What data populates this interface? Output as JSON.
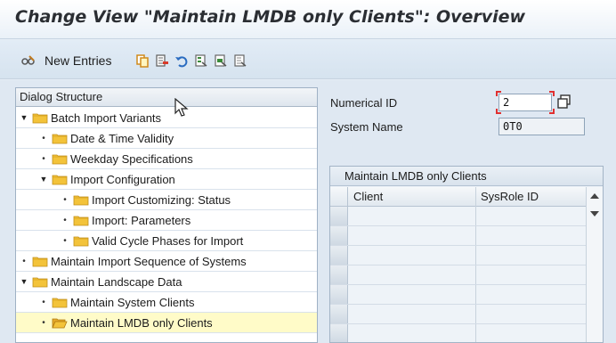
{
  "title": "Change View \"Maintain LMDB only Clients\": Overview",
  "toolbar": {
    "new_entries_label": "New Entries",
    "icons": [
      "glasses-icon",
      "copy-icon",
      "delete-icon",
      "undo-icon",
      "select-all-icon",
      "select-block-icon",
      "deselect-all-icon"
    ]
  },
  "tree": {
    "header": "Dialog Structure",
    "items": [
      {
        "label": "Batch Import Variants",
        "type": "expanded",
        "level": 0
      },
      {
        "label": "Date & Time Validity",
        "type": "leaf",
        "level": 1
      },
      {
        "label": "Weekday Specifications",
        "type": "leaf",
        "level": 1
      },
      {
        "label": "Import Configuration",
        "type": "expanded",
        "level": 1
      },
      {
        "label": "Import Customizing: Status",
        "type": "leaf",
        "level": 2
      },
      {
        "label": "Import: Parameters",
        "type": "leaf",
        "level": 2
      },
      {
        "label": "Valid Cycle Phases for Import",
        "type": "leaf",
        "level": 2
      },
      {
        "label": "Maintain Import Sequence of Systems",
        "type": "leaf",
        "level": 0
      },
      {
        "label": "Maintain Landscape Data",
        "type": "expanded",
        "level": 0
      },
      {
        "label": "Maintain System Clients",
        "type": "leaf",
        "level": 1
      },
      {
        "label": "Maintain LMDB only Clients",
        "type": "leaf-open",
        "level": 1,
        "selected": true
      }
    ]
  },
  "fields": {
    "numerical_id_label": "Numerical ID",
    "numerical_id_value": "2",
    "system_name_label": "System Name",
    "system_name_value": "0T0"
  },
  "table": {
    "title": "Maintain LMDB only Clients",
    "columns": [
      "Client",
      "SysRole ID"
    ]
  },
  "colors": {
    "selected_row": "#fffbc8",
    "folder": "#f3c33a",
    "bracket": "#e03030"
  }
}
